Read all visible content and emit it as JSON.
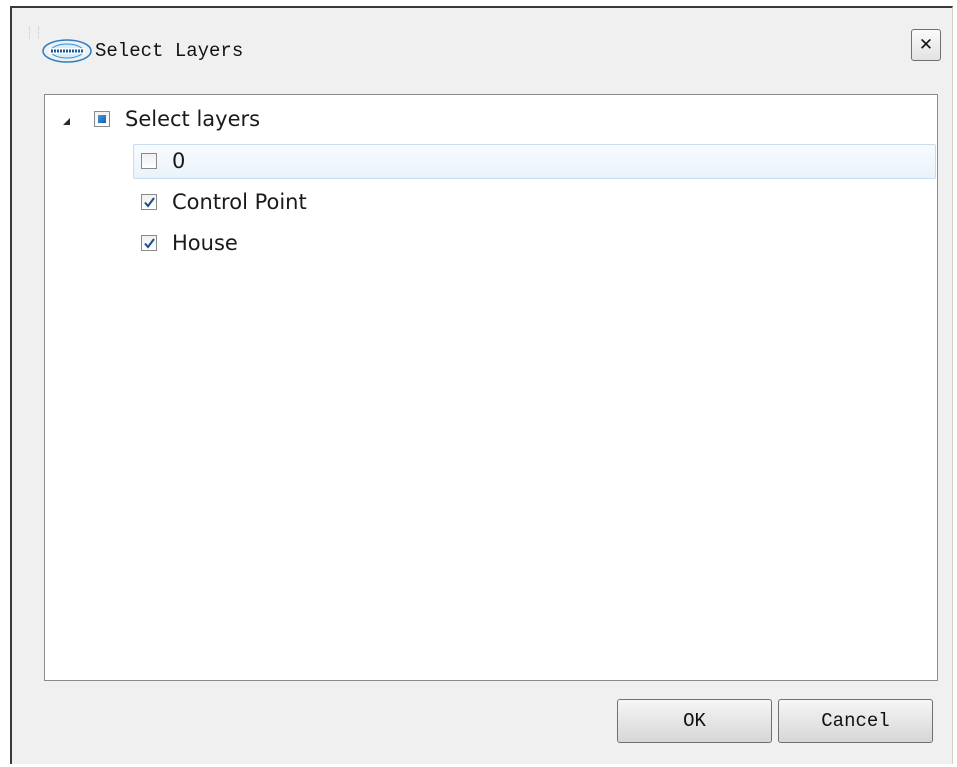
{
  "window": {
    "title": "Select Layers",
    "close_glyph": "✕"
  },
  "tree": {
    "root": {
      "label": "Select layers",
      "state": "indeterminate",
      "expanded": true
    },
    "children": [
      {
        "label": "0",
        "checked": false,
        "highlighted": true
      },
      {
        "label": "Control Point",
        "checked": true,
        "highlighted": false
      },
      {
        "label": "House",
        "checked": true,
        "highlighted": false
      }
    ]
  },
  "buttons": {
    "ok_label": "OK",
    "cancel_label": "Cancel"
  },
  "icons": {
    "app": "app-logo-icon",
    "close": "close-icon",
    "expander": "tree-expanded-icon",
    "check": "checkmark-icon"
  },
  "colors": {
    "dialog_bg": "#f0f0f0",
    "panel_bg": "#ffffff",
    "check_color": "#1b4f8a",
    "indeterminate_fill": "#1b5fa8"
  }
}
